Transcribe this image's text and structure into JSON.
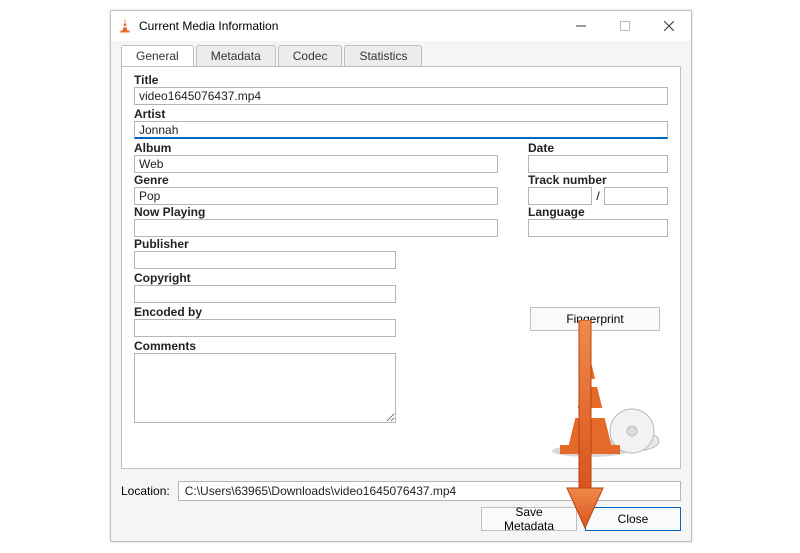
{
  "window": {
    "title": "Current Media Information"
  },
  "tabs": {
    "general": "General",
    "metadata": "Metadata",
    "codec": "Codec",
    "statistics": "Statistics"
  },
  "fields": {
    "title_label": "Title",
    "title_value": "video1645076437.mp4",
    "artist_label": "Artist",
    "artist_value": "Jonnah",
    "album_label": "Album",
    "album_value": "Web",
    "date_label": "Date",
    "date_value": "",
    "genre_label": "Genre",
    "genre_value": "Pop",
    "tracknum_label": "Track number",
    "tracknum_value": "",
    "tracktotal_value": "",
    "track_sep": "/",
    "nowplaying_label": "Now Playing",
    "nowplaying_value": "",
    "language_label": "Language",
    "language_value": "",
    "publisher_label": "Publisher",
    "publisher_value": "",
    "copyright_label": "Copyright",
    "copyright_value": "",
    "encodedby_label": "Encoded by",
    "encodedby_value": "",
    "comments_label": "Comments",
    "comments_value": ""
  },
  "buttons": {
    "fingerprint": "Fingerprint",
    "save_metadata": "Save Metadata",
    "close": "Close"
  },
  "location": {
    "label": "Location:",
    "value": "C:\\Users\\63965\\Downloads\\video1645076437.mp4"
  },
  "colors": {
    "accent": "#0067c0",
    "arrow": "#e46a2a"
  }
}
